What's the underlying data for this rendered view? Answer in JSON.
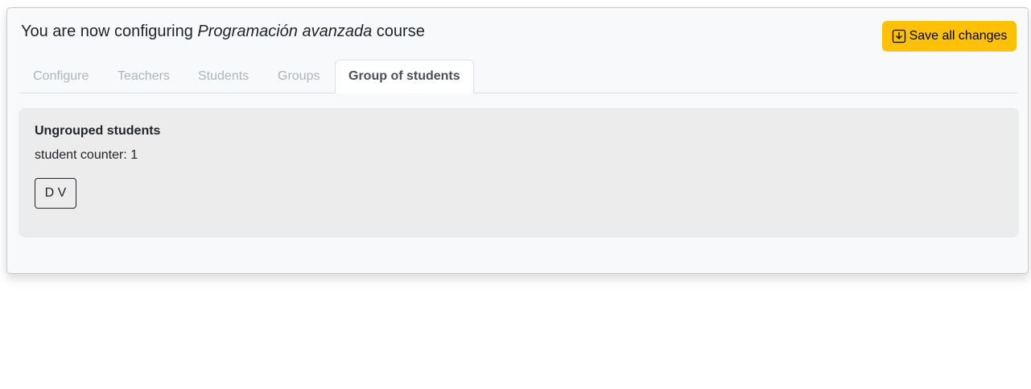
{
  "header": {
    "title_prefix": "You are now configuring",
    "course_name": "Programación avanzada",
    "title_suffix": "course",
    "save_label": "Save all changes",
    "save_icon": "download-box-icon"
  },
  "tabs": [
    {
      "label": "Configure",
      "active": false
    },
    {
      "label": "Teachers",
      "active": false
    },
    {
      "label": "Students",
      "active": false
    },
    {
      "label": "Groups",
      "active": false
    },
    {
      "label": "Group of students",
      "active": true
    }
  ],
  "ungrouped": {
    "heading": "Ungrouped students",
    "counter_label": "student counter:",
    "counter_value": "1",
    "students": [
      "D V"
    ]
  },
  "colors": {
    "accent": "#ffc107",
    "card_bg": "#f8f9fa",
    "panel_bg": "#ececec",
    "tab_inactive": "#adb5bd",
    "tab_active": "#495057"
  }
}
